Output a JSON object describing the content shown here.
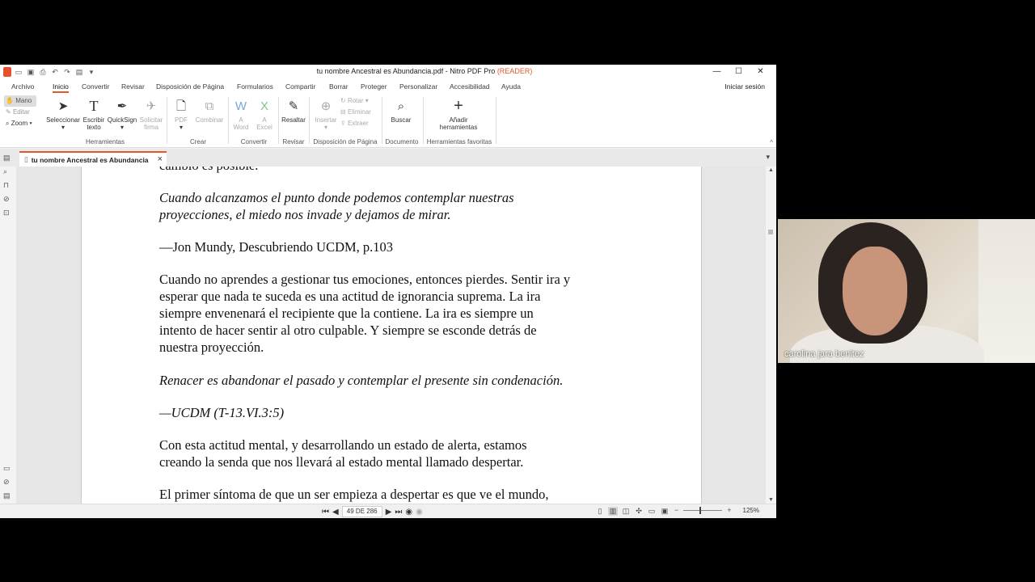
{
  "window": {
    "title": "tu nombre Ancestral es Abundancia.pdf - Nitro PDF Pro",
    "title_suffix": "(READER)",
    "controls": [
      "—",
      "☐",
      "✕"
    ]
  },
  "menu": {
    "items": [
      "Archivo",
      "Inicio",
      "Convertir",
      "Revisar",
      "Disposición de Página",
      "Formularios",
      "Compartir",
      "Borrar",
      "Proteger",
      "Personalizar",
      "Accesibilidad",
      "Ayuda"
    ],
    "active": "Inicio",
    "signin": "Iniciar sesión"
  },
  "ribbon": {
    "modes": [
      "Mano",
      "Editar",
      "Zoom"
    ],
    "tools": {
      "select": "Seleccionar",
      "type_text": "Escribir texto",
      "quicksign": "QuickSign",
      "request_sign": "Solicitar firma",
      "pdf": "PDF",
      "combine": "Combinar",
      "to_word": "A Word",
      "to_excel": "A Excel",
      "highlight": "Resaltar",
      "insert": "Insertar",
      "rotate": "Rotar",
      "delete": "Eliminar",
      "extract": "Extraer",
      "search": "Buscar",
      "add_tools": "Añadir herramientas"
    },
    "groups": {
      "tools": "Herramientas",
      "create": "Crear",
      "convert": "Convertir",
      "review": "Revisar",
      "layout": "Disposición de Página",
      "document": "Documento",
      "favorites": "Herramientas favoritas"
    }
  },
  "tab": {
    "label": "tu nombre Ancestral es Abundancia"
  },
  "page": {
    "lines": [
      {
        "text": "cambio es posible.",
        "italic": false
      },
      {
        "text": "Cuando alcanzamos el punto donde podemos contemplar nuestras",
        "italic": true
      },
      {
        "text": "proyecciones, el miedo nos invade y dejamos de mirar.",
        "italic": true
      },
      {
        "text": "—Jon Mundy, Descubriendo UCDM, p.103",
        "italic": false
      },
      {
        "text": "Cuando no aprendes a gestionar tus emociones, entonces pierdes. Sentir ira y",
        "italic": false
      },
      {
        "text": "esperar que nada te suceda es una actitud de ignorancia suprema. La ira",
        "italic": false
      },
      {
        "text": "siempre envenenará el recipiente que la contiene. La ira es siempre un",
        "italic": false
      },
      {
        "text": "intento de hacer sentir al otro culpable. Y siempre se esconde detrás de",
        "italic": false
      },
      {
        "text": "nuestra proyección.",
        "italic": false
      },
      {
        "text": "Renacer es abandonar el pasado y contemplar el presente sin condenación.",
        "italic": true
      },
      {
        "text": "—UCDM (T-13.VI.3:5)",
        "italic": true
      },
      {
        "text": "Con esta actitud mental, y desarrollando un estado de alerta, estamos",
        "italic": false
      },
      {
        "text": "creando la senda que nos llevará al estado mental llamado despertar.",
        "italic": false
      },
      {
        "text": "El primer síntoma de que un ser empieza a despertar es que ve el mundo,",
        "italic": false
      }
    ]
  },
  "status": {
    "page_indicator": "49 DE 286",
    "zoom": "125%"
  },
  "video": {
    "participant_name": "carolina jara benitez"
  },
  "colors": {
    "accent": "#e05a2b",
    "background": "#000000"
  }
}
